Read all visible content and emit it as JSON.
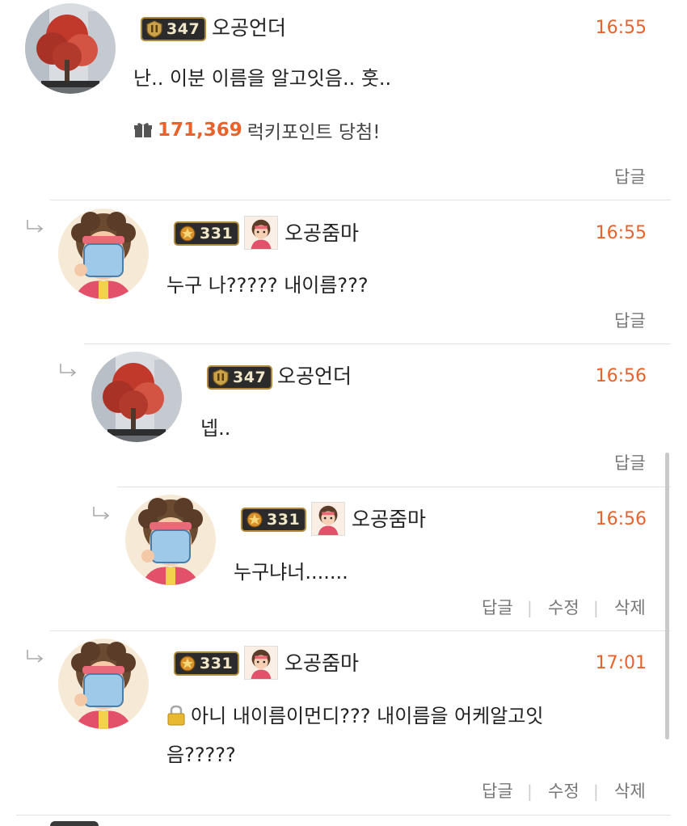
{
  "comments": [
    {
      "nickname": "오공언더",
      "level": "347",
      "time": "16:55",
      "message": "난.. 이분 이름을 알고잇음.. 훗..",
      "lucky": {
        "points": "171,369",
        "text": "럭키포인트 당첨!"
      },
      "actions": {
        "reply": "답글"
      }
    },
    {
      "nickname": "오공줌마",
      "level": "331",
      "time": "16:55",
      "message": "누구 나????? 내이름???",
      "actions": {
        "reply": "답글"
      }
    },
    {
      "nickname": "오공언더",
      "level": "347",
      "time": "16:56",
      "message": "넵..",
      "actions": {
        "reply": "답글"
      }
    },
    {
      "nickname": "오공줌마",
      "level": "331",
      "time": "16:56",
      "message": "누구냐너.......",
      "actions": {
        "reply": "답글",
        "edit": "수정",
        "delete": "삭제"
      }
    },
    {
      "nickname": "오공줌마",
      "level": "331",
      "time": "17:01",
      "message_line1": "아니 내이름이먼디??? 내이름을 어케알고잇",
      "message_line2": "음?????",
      "actions": {
        "reply": "답글",
        "edit": "수정",
        "delete": "삭제"
      }
    }
  ],
  "colors": {
    "accent": "#e8622c",
    "text": "#222222",
    "muted": "#777777",
    "divider": "#e2e2e2"
  },
  "icons": [
    "reply-arrow-icon",
    "gift-icon",
    "lock-icon",
    "level-emblem-icon"
  ]
}
